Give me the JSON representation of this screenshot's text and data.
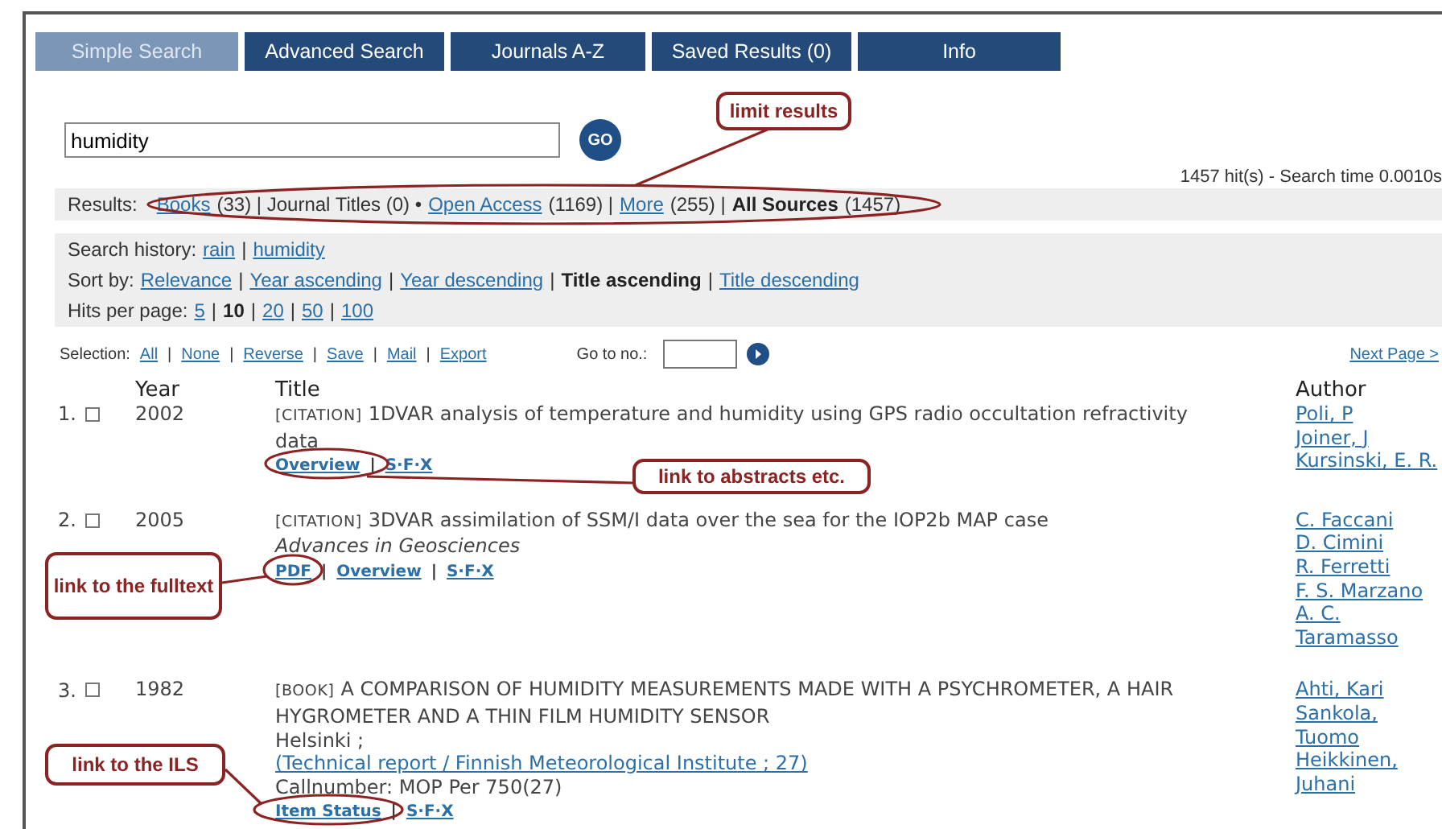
{
  "tabs": [
    {
      "label": "Simple Search",
      "selected": true
    },
    {
      "label": "Advanced Search",
      "selected": false
    },
    {
      "label": "Journals A-Z",
      "selected": false
    },
    {
      "label": "Saved Results (0)",
      "selected": false
    },
    {
      "label": "Info",
      "selected": false
    }
  ],
  "search": {
    "value": "humidity",
    "button": "GO"
  },
  "hits_info": "1457 hit(s) - Search time 0.0010s",
  "results": {
    "label": "Results:",
    "segments": [
      {
        "kind": "link",
        "text": "Books"
      },
      {
        "kind": "text",
        "text": "(33) | Journal Titles (0) •"
      },
      {
        "kind": "link",
        "text": "Open Access"
      },
      {
        "kind": "text",
        "text": "(1169) |"
      },
      {
        "kind": "link",
        "text": "More"
      },
      {
        "kind": "text",
        "text": "(255) |"
      },
      {
        "kind": "bold",
        "text": "All Sources"
      },
      {
        "kind": "text",
        "text": "(1457)"
      }
    ]
  },
  "search_history": {
    "label": "Search history:",
    "separator": "|",
    "items": [
      "rain",
      "humidity"
    ]
  },
  "sort_by": {
    "label": "Sort by:",
    "separator": "|",
    "options": [
      {
        "label": "Relevance",
        "selected": false
      },
      {
        "label": "Year ascending",
        "selected": false
      },
      {
        "label": "Year descending",
        "selected": false
      },
      {
        "label": "Title ascending",
        "selected": true
      },
      {
        "label": "Title descending",
        "selected": false
      }
    ]
  },
  "hits_per_page": {
    "label": "Hits per page:",
    "separator": "|",
    "options": [
      {
        "label": "5",
        "selected": false
      },
      {
        "label": "10",
        "selected": true
      },
      {
        "label": "20",
        "selected": false
      },
      {
        "label": "50",
        "selected": false
      },
      {
        "label": "100",
        "selected": false
      }
    ]
  },
  "selection": {
    "label": "Selection:",
    "separator": "|",
    "actions": [
      "All",
      "None",
      "Reverse",
      "Save",
      "Mail",
      "Export"
    ],
    "goto_label": "Go to no.:",
    "next_page": "Next Page >"
  },
  "table": {
    "columns": [
      "Year",
      "Title",
      "Author"
    ],
    "separator": "|",
    "rows": [
      {
        "number": "1.",
        "checked": false,
        "year": "2002",
        "type": "[CITATION]",
        "title": "1DVAR analysis of temperature and humidity using GPS radio occultation refractivity data",
        "links": [
          "Overview",
          "S·F·X"
        ],
        "authors": [
          "Poli, P",
          "Joiner, J",
          "Kursinski, E. R."
        ]
      },
      {
        "number": "2.",
        "checked": false,
        "year": "2005",
        "type": "[CITATION]",
        "title": "3DVAR assimilation of SSM/I data over the sea for the IOP2b MAP case",
        "source": "Advances in Geosciences",
        "links": [
          "PDF",
          "Overview",
          "S·F·X"
        ],
        "authors": [
          "C. Faccani",
          "D. Cimini",
          "R. Ferretti",
          "F. S. Marzano",
          "A. C. Taramasso"
        ]
      },
      {
        "number": "3.",
        "checked": false,
        "year": "1982",
        "type": "[BOOK]",
        "title": "A COMPARISON OF HUMIDITY MEASUREMENTS MADE WITH A PSYCHROMETER, A HAIR HYGROMETER AND A THIN FILM HUMIDITY SENSOR",
        "place": "Helsinki ;",
        "series": "(Technical report / Finnish Meteorological Institute ; 27)",
        "callnumber": "Callnumber: MOP Per 750(27)",
        "links": [
          "Item Status",
          "S·F·X"
        ],
        "authors": [
          "Ahti, Kari",
          "Sankola, Tuomo",
          "Heikkinen, Juhani"
        ]
      }
    ]
  },
  "annotations": [
    {
      "text": "limit results"
    },
    {
      "text": "link to abstracts etc."
    },
    {
      "text": "link to the fulltext"
    },
    {
      "text": "link to the ILS"
    }
  ]
}
